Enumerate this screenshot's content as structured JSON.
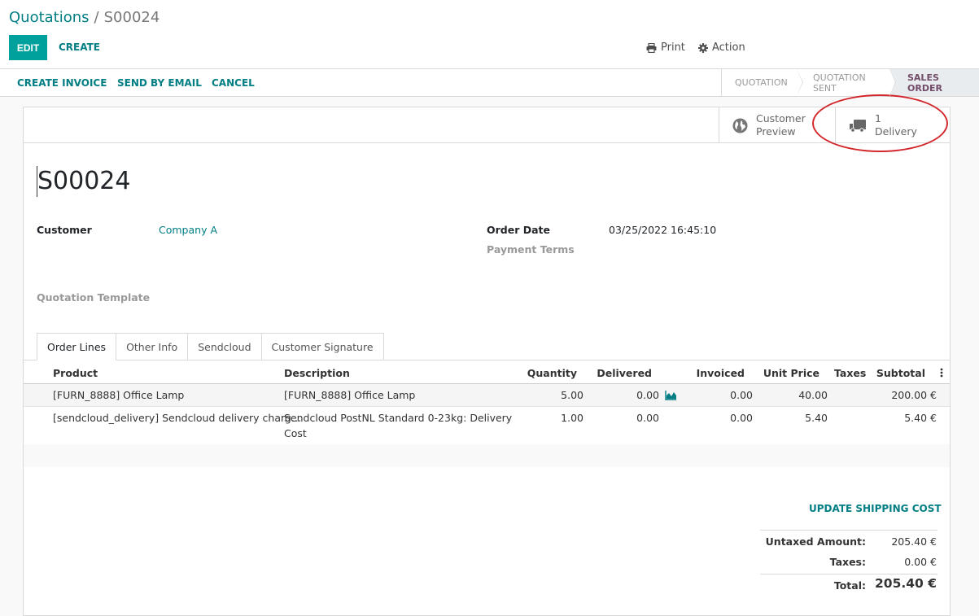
{
  "breadcrumb": {
    "parent": "Quotations",
    "separator": "/",
    "current": "S00024"
  },
  "toolbar": {
    "edit_label": "EDIT",
    "create_label": "CREATE",
    "print_label": "Print",
    "action_label": "Action"
  },
  "statusbar": {
    "buttons": [
      "CREATE INVOICE",
      "SEND BY EMAIL",
      "CANCEL"
    ],
    "stages": [
      "QUOTATION",
      "QUOTATION SENT",
      "SALES ORDER"
    ],
    "active_stage": "SALES ORDER"
  },
  "smart_buttons": {
    "preview": {
      "line1": "Customer",
      "line2": "Preview",
      "icon": "globe-icon"
    },
    "delivery": {
      "line1": "1",
      "line2": "Delivery",
      "icon": "truck-icon"
    }
  },
  "record": {
    "name": "S00024",
    "customer_label": "Customer",
    "customer_value": "Company A",
    "order_date_label": "Order Date",
    "order_date_value": "03/25/2022 16:45:10",
    "payment_terms_label": "Payment Terms",
    "quotation_template_label": "Quotation Template"
  },
  "tabs": [
    "Order Lines",
    "Other Info",
    "Sendcloud",
    "Customer Signature"
  ],
  "table": {
    "headers": [
      "Product",
      "Description",
      "Quantity",
      "Delivered",
      "Invoiced",
      "Unit Price",
      "Taxes",
      "Subtotal"
    ],
    "rows": [
      {
        "product": "[FURN_8888] Office Lamp",
        "description": "[FURN_8888] Office Lamp",
        "description2": "",
        "quantity": "5.00",
        "delivered": "0.00",
        "invoiced": "0.00",
        "unit_price": "40.00",
        "taxes": "",
        "subtotal": "200.00 €"
      },
      {
        "product": "[sendcloud_delivery] Sendcloud delivery charg…",
        "description": "Sendcloud PostNL Standard 0-23kg: Delivery",
        "description2": "Cost",
        "quantity": "1.00",
        "delivered": "0.00",
        "invoiced": "0.00",
        "unit_price": "5.40",
        "taxes": "",
        "subtotal": "5.40 €"
      }
    ]
  },
  "summary": {
    "update_shipping_label": "UPDATE SHIPPING COST",
    "untaxed_label": "Untaxed Amount:",
    "untaxed_value": "205.40 €",
    "taxes_label": "Taxes:",
    "taxes_value": "0.00 €",
    "total_label": "Total:",
    "total_value": "205.40 €"
  },
  "colors": {
    "primary": "#00a09d",
    "link": "#017e84",
    "active_stage": "#714b67",
    "annotation": "#d3272c"
  }
}
